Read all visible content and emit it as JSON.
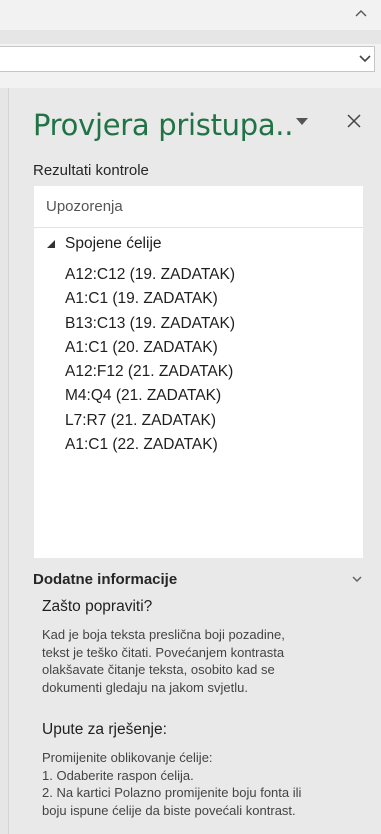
{
  "pane": {
    "title": "Provjera pristupa..",
    "results_label": "Rezultati kontrole",
    "results_heading": "Upozorenja",
    "group": {
      "label": "Spojene ćelije",
      "expanded": true,
      "items": [
        "A12:C12 (19. ZADATAK)",
        "A1:C1 (19. ZADATAK)",
        "B13:C13 (19. ZADATAK)",
        "A1:C1 (20. ZADATAK)",
        "A12:F12 (21. ZADATAK)",
        "M4:Q4 (21. ZADATAK)",
        "L7:R7 (21. ZADATAK)",
        "A1:C1 (22. ZADATAK)"
      ]
    },
    "additional_info": {
      "title": "Dodatne informacije",
      "why_heading": "Zašto popraviti?",
      "why_lines": [
        "Kad je boja teksta preslična boji pozadine,",
        "tekst je teško čitati. Povećanjem kontrasta",
        "olakšavate čitanje teksta, osobito kad se",
        "dokumenti gledaju na jakom svjetlu."
      ],
      "fix_heading": "Upute za rješenje:",
      "fix_lines": [
        "Promijenite oblikovanje ćelije:",
        "1. Odaberite raspon ćelija.",
        "2. Na kartici Polazno promijenite boju fonta ili",
        "boju ispune ćelije da biste povećali kontrast."
      ]
    }
  },
  "icons": {
    "collapse": "chevron-up-icon",
    "expand": "chevron-down-icon",
    "pane_menu": "dropdown-triangle-icon",
    "close": "close-icon",
    "group_toggle": "expanded-triangle-icon",
    "info_toggle": "chevron-down-icon"
  },
  "colors": {
    "title": "#217346",
    "pane_background": "#e9e9e9",
    "results_background": "#ffffff"
  }
}
